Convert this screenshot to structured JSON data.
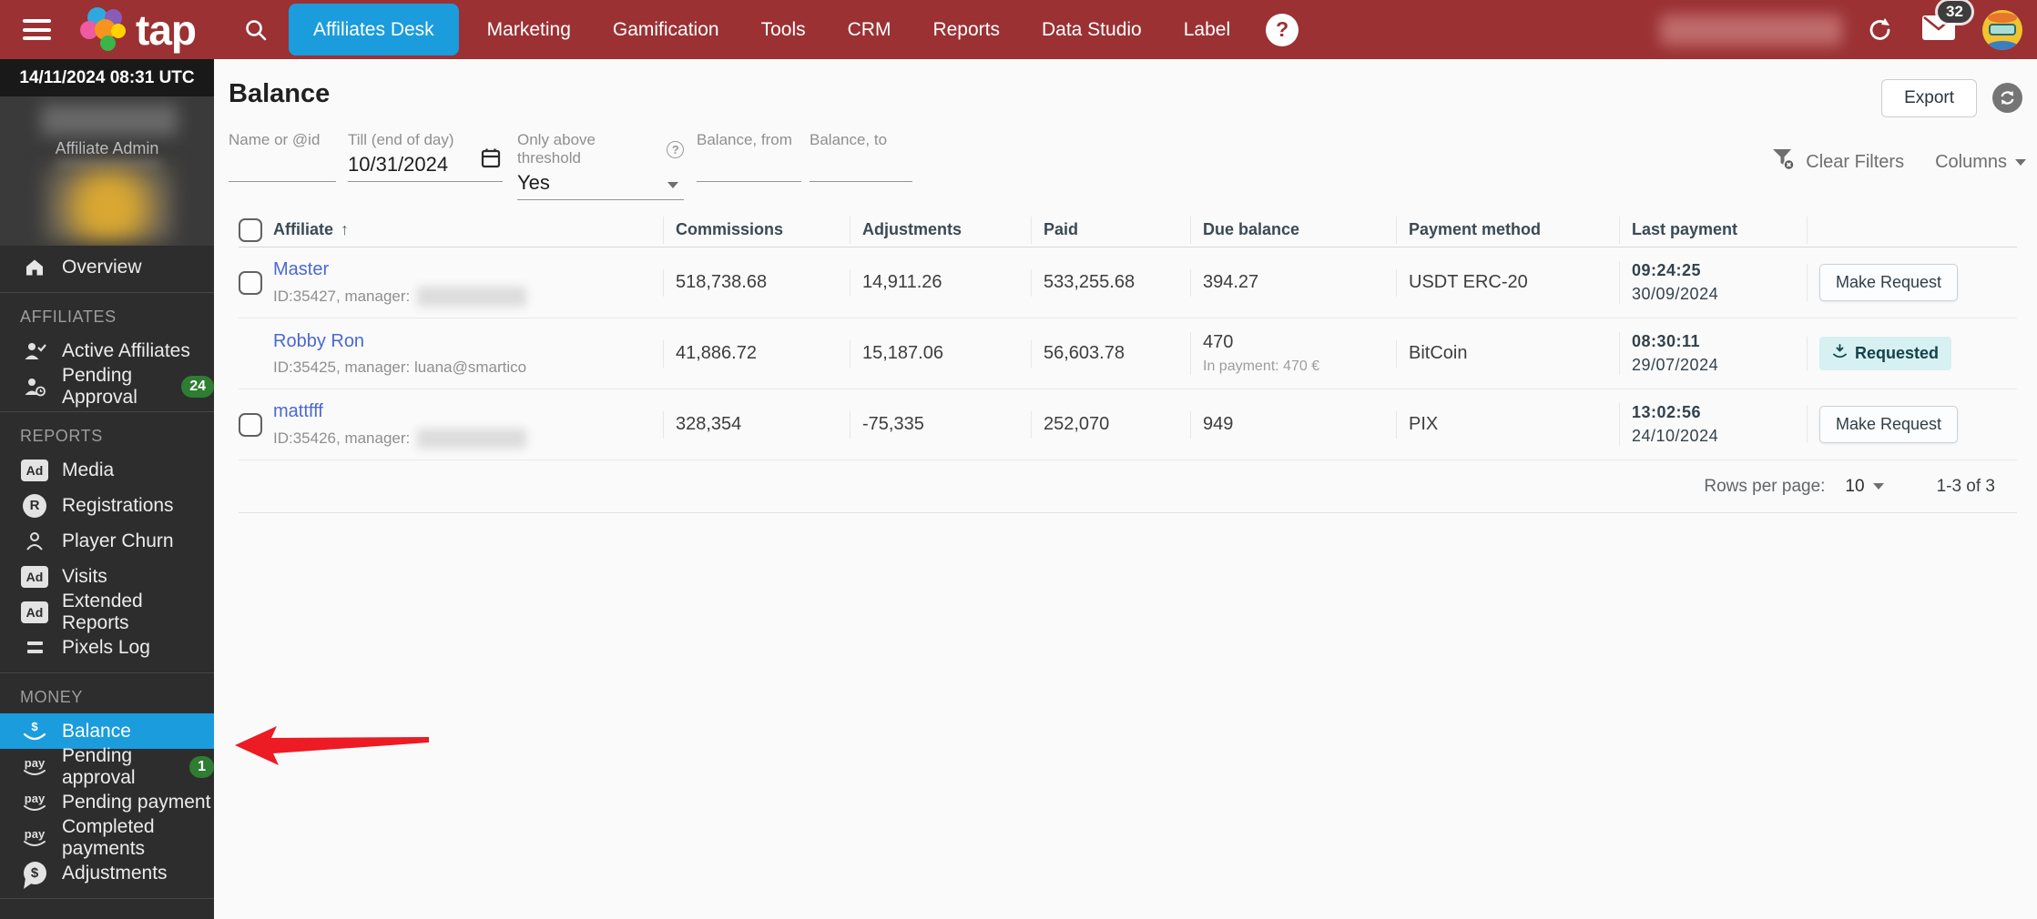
{
  "topbar": {
    "brand": "tap",
    "nav_items": [
      {
        "label": "Affiliates Desk"
      },
      {
        "label": "Marketing"
      },
      {
        "label": "Gamification"
      },
      {
        "label": "Tools"
      },
      {
        "label": "CRM"
      },
      {
        "label": "Reports"
      },
      {
        "label": "Data Studio"
      },
      {
        "label": "Label"
      }
    ],
    "help_glyph": "?",
    "mail_badge": "32"
  },
  "sidebar": {
    "timestamp": "14/11/2024 08:31 UTC",
    "role": "Affiliate Admin",
    "overview_label": "Overview",
    "sections": [
      {
        "title": "AFFILIATES",
        "items": [
          {
            "label": "Active Affiliates"
          },
          {
            "label": "Pending Approval",
            "badge": "24"
          }
        ]
      },
      {
        "title": "REPORTS",
        "items": [
          {
            "label": "Media"
          },
          {
            "label": "Registrations"
          },
          {
            "label": "Player Churn"
          },
          {
            "label": "Visits"
          },
          {
            "label": "Extended Reports"
          },
          {
            "label": "Pixels Log"
          }
        ]
      },
      {
        "title": "MONEY",
        "items": [
          {
            "label": "Balance"
          },
          {
            "label": "Pending approval",
            "badge": "1"
          },
          {
            "label": "Pending payment"
          },
          {
            "label": "Completed payments"
          },
          {
            "label": "Adjustments"
          }
        ]
      }
    ]
  },
  "icon_glyphs": {
    "ad": "Ad",
    "r": "R",
    "pay": "pay",
    "dollar": "$",
    "question": "?"
  },
  "page": {
    "title": "Balance",
    "export_label": "Export",
    "clear_filters_label": "Clear Filters",
    "columns_label": "Columns",
    "filters": [
      {
        "label": "Name or @id",
        "value": ""
      },
      {
        "label": "Till (end of day)",
        "value": "10/31/2024"
      },
      {
        "label": "Only above threshold",
        "value": "Yes",
        "help": "?"
      },
      {
        "label": "Balance, from",
        "value": ""
      },
      {
        "label": "Balance, to",
        "value": ""
      }
    ]
  },
  "table": {
    "sort_arrow": "↑",
    "headers": {
      "affiliate": "Affiliate",
      "commissions": "Commissions",
      "adjustments": "Adjustments",
      "paid": "Paid",
      "due": "Due balance",
      "method": "Payment method",
      "last": "Last payment"
    },
    "rows": [
      {
        "name": "Master",
        "meta": "ID:35427, manager:",
        "commissions": "518,738.68",
        "adjustments": "14,911.26",
        "paid": "533,255.68",
        "due": "394.27",
        "method": "USDT ERC-20",
        "time": "09:24:25",
        "date": "30/09/2024",
        "action": "Make Request"
      },
      {
        "name": "Robby Ron",
        "meta": "ID:35425, manager: luana@smartico",
        "commissions": "41,886.72",
        "adjustments": "15,187.06",
        "paid": "56,603.78",
        "due": "470",
        "due_sub": "In payment: 470 €",
        "method": "BitCoin",
        "time": "08:30:11",
        "date": "29/07/2024",
        "action": "Requested"
      },
      {
        "name": "mattfff",
        "meta": "ID:35426, manager:",
        "commissions": "328,354",
        "adjustments": "-75,335",
        "paid": "252,070",
        "due": "949",
        "method": "PIX",
        "time": "13:02:56",
        "date": "24/10/2024",
        "action": "Make Request"
      }
    ],
    "footer": {
      "rows_per_page_label": "Rows per page:",
      "rows_per_page_value": "10",
      "range": "1-3 of 3"
    }
  }
}
